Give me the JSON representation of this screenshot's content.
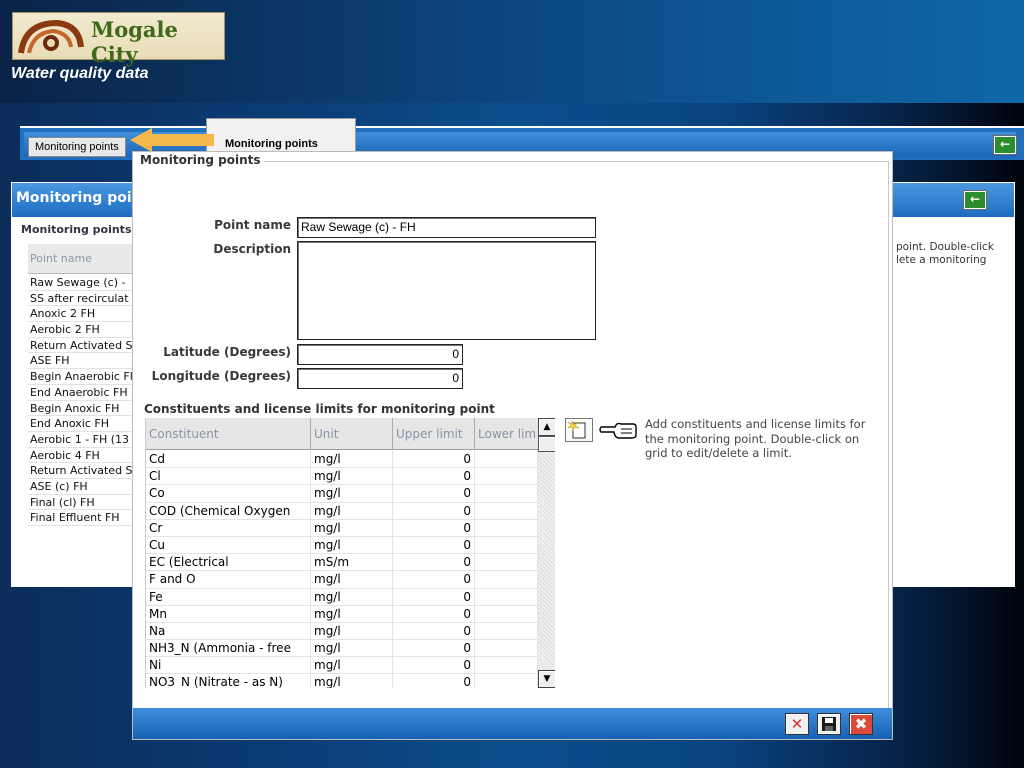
{
  "header": {
    "logo_text": "Mogale City",
    "app_title": "Water quality data"
  },
  "toolbar": {
    "monitoring_points_button": "Monitoring points",
    "back_icon": "green-back-arrow-icon"
  },
  "callout": {
    "text": "Monitoring points",
    "color": "#f5b84a"
  },
  "back_window": {
    "title": "Monitoring point",
    "section_title": "Monitoring points",
    "column_header": "Point name",
    "items": [
      "Raw Sewage (c) -",
      "SS after recirculat",
      "Anoxic 2 FH",
      "Aerobic 2 FH",
      "Return Activated S",
      "ASE  FH",
      "Begin Anaerobic Fl",
      "End Anaerobic FH",
      "Begin Anoxic  FH",
      "End Anoxic  FH",
      "Aerobic 1 - FH (13",
      "Aerobic 4  FH",
      "Return Activated S",
      "ASE (c)  FH",
      "Final (cl) FH",
      "Final Effluent FH"
    ],
    "hint_partial": "point. Double-click\nlete a monitoring"
  },
  "dialog": {
    "legend": "Monitoring points",
    "fields": {
      "point_name_label": "Point name",
      "point_name_value": "Raw Sewage (c) - FH",
      "description_label": "Description",
      "description_value": "",
      "latitude_label": "Latitude (Degrees)",
      "latitude_value": "0",
      "longitude_label": "Longitude (Degrees)",
      "longitude_value": "0"
    },
    "constituents_title": "Constituents and license limits for monitoring point",
    "grid": {
      "columns": [
        "Constituent",
        "Unit",
        "Upper limit",
        "Lower lim"
      ],
      "rows": [
        [
          "Cd",
          "mg/l",
          "0",
          ""
        ],
        [
          "Cl",
          "mg/l",
          "0",
          ""
        ],
        [
          "Co",
          "mg/l",
          "0",
          ""
        ],
        [
          "COD (Chemical Oxygen",
          "mg/l",
          "0",
          ""
        ],
        [
          "Cr",
          "mg/l",
          "0",
          ""
        ],
        [
          "Cu",
          "mg/l",
          "0",
          ""
        ],
        [
          "EC (Electrical",
          "mS/m",
          "0",
          ""
        ],
        [
          "F and O",
          "mg/l",
          "0",
          ""
        ],
        [
          "Fe",
          "mg/l",
          "0",
          ""
        ],
        [
          "Mn",
          "mg/l",
          "0",
          ""
        ],
        [
          "Na",
          "mg/l",
          "0",
          ""
        ],
        [
          "NH3_N (Ammonia - free",
          "mg/l",
          "0",
          ""
        ],
        [
          "Ni",
          "mg/l",
          "0",
          ""
        ],
        [
          "NO3_N  (Nitrate - as N)",
          "mg/l",
          "0",
          ""
        ]
      ]
    },
    "hint": "Add constituents and license limits for the monitoring point. Double-click on grid to edit/delete a limit.",
    "footer_buttons": [
      "delete-icon",
      "save-icon",
      "close-icon"
    ]
  }
}
